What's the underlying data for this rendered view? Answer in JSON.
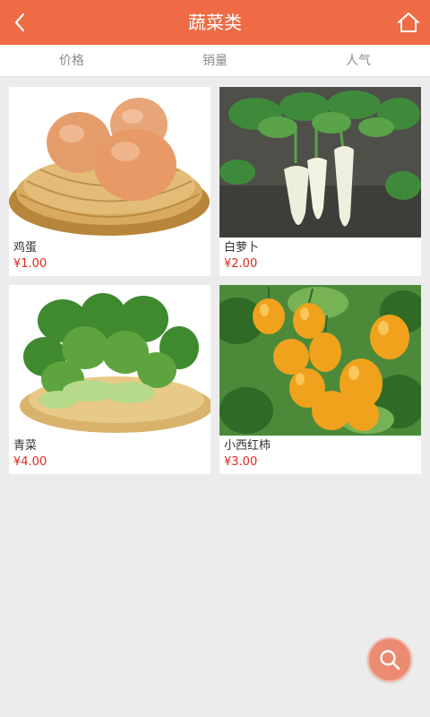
{
  "header": {
    "title": "蔬菜类",
    "back_icon": "back-arrow-icon",
    "home_icon": "home-icon"
  },
  "sort_tabs": [
    {
      "label": "价格"
    },
    {
      "label": "销量"
    },
    {
      "label": "人气"
    }
  ],
  "products": [
    {
      "name": "鸡蛋",
      "price": "¥1.00"
    },
    {
      "name": "白萝卜",
      "price": "¥2.00"
    },
    {
      "name": "青菜",
      "price": "¥4.00"
    },
    {
      "name": "小西红柿",
      "price": "¥3.00"
    }
  ],
  "search_fab": {
    "icon": "search-icon"
  },
  "colors": {
    "header": "#ee6b45",
    "price": "#e0281e",
    "fab": "#ea8b72",
    "background": "#ececec"
  }
}
